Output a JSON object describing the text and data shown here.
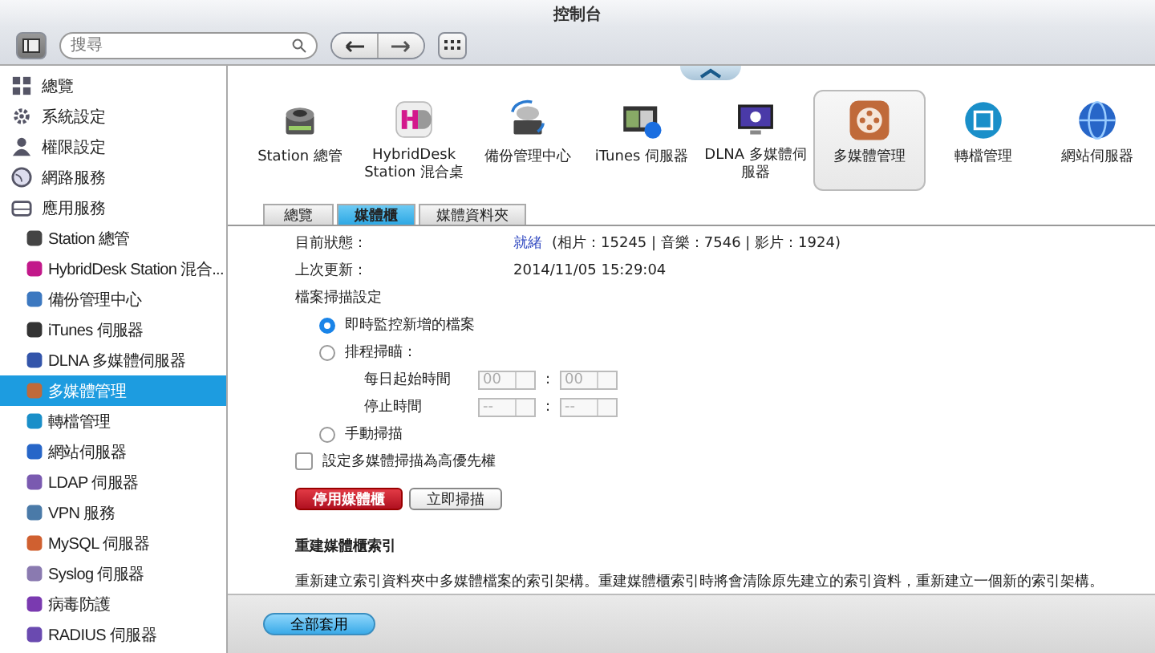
{
  "window": {
    "title": "控制台"
  },
  "toolbar": {
    "search": {
      "placeholder": "搜尋"
    }
  },
  "sidebar": {
    "items": [
      {
        "label": "總覽",
        "selected": false
      },
      {
        "label": "系統設定",
        "selected": false
      },
      {
        "label": "權限設定",
        "selected": false
      },
      {
        "label": "網路服務",
        "selected": false
      },
      {
        "label": "應用服務",
        "selected": false,
        "children": [
          {
            "label": "Station 總管",
            "selected": false
          },
          {
            "label": "HybridDesk Station 混合...",
            "selected": false
          },
          {
            "label": "備份管理中心",
            "selected": false
          },
          {
            "label": "iTunes 伺服器",
            "selected": false
          },
          {
            "label": "DLNA 多媒體伺服器",
            "selected": false
          },
          {
            "label": "多媒體管理",
            "selected": true
          },
          {
            "label": "轉檔管理",
            "selected": false
          },
          {
            "label": "網站伺服器",
            "selected": false
          },
          {
            "label": "LDAP 伺服器",
            "selected": false
          },
          {
            "label": "VPN 服務",
            "selected": false
          },
          {
            "label": "MySQL 伺服器",
            "selected": false
          },
          {
            "label": "Syslog 伺服器",
            "selected": false
          },
          {
            "label": "病毒防護",
            "selected": false
          },
          {
            "label": "RADIUS 伺服器",
            "selected": false
          }
        ]
      }
    ]
  },
  "apps": [
    {
      "label": "Station 總管",
      "selected": false
    },
    {
      "label": "HybridDesk Station 混合桌",
      "selected": false
    },
    {
      "label": "備份管理中心",
      "selected": false
    },
    {
      "label": "iTunes 伺服器",
      "selected": false
    },
    {
      "label": "DLNA 多媒體伺服器",
      "selected": false
    },
    {
      "label": "多媒體管理",
      "selected": true
    },
    {
      "label": "轉檔管理",
      "selected": false
    },
    {
      "label": "網站伺服器",
      "selected": false
    }
  ],
  "tabs": [
    {
      "label": "總覽",
      "selected": false
    },
    {
      "label": "媒體櫃",
      "selected": true
    },
    {
      "label": "媒體資料夾",
      "selected": false
    }
  ],
  "content": {
    "status_label": "目前狀態：",
    "status_value": "就緒",
    "status_detail": "(相片：15245 | 音樂：7546 | 影片：1924)",
    "update_label": "上次更新：",
    "update_value": "2014/11/05 15:29:04",
    "scan_heading": "檔案掃描設定",
    "scan_options": [
      {
        "kind": "plain",
        "label": "即時監控新增的檔案",
        "selected": true
      },
      {
        "kind": "schedule",
        "label": "排程掃瞄：",
        "selected": false,
        "rows": [
          {
            "label": "每日起始時間",
            "hour": "00",
            "minute": "00",
            "separator": ":"
          },
          {
            "label": "停止時間",
            "hour": "--",
            "minute": "--",
            "separator": ":"
          }
        ]
      },
      {
        "kind": "plain",
        "label": "手動掃描",
        "selected": false
      }
    ],
    "priority": {
      "label": "設定多媒體掃描為高優先權",
      "checked": false
    },
    "buttons": [
      {
        "kind": "danger",
        "label": "停用媒體櫃"
      },
      {
        "kind": "normal",
        "label": "立即掃描"
      }
    ],
    "rebuild_heading": "重建媒體櫃索引",
    "rebuild_text": "重新建立索引資料夾中多媒體檔案的索引架構。重建媒體櫃索引時將會清除原先建立的索引資料，重新建立一個新的索引架構。"
  },
  "footer": {
    "apply": "全部套用"
  }
}
